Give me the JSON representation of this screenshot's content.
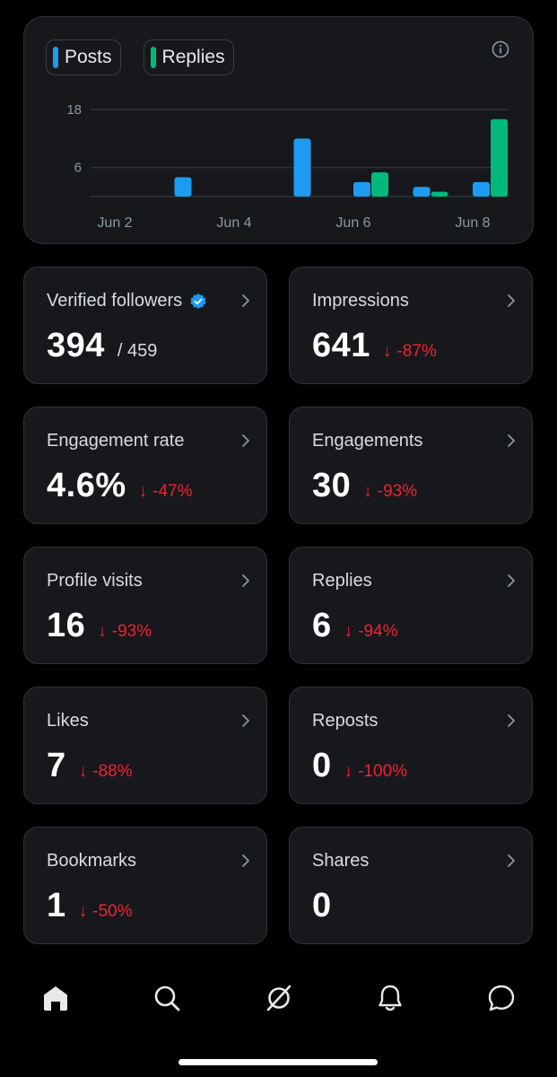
{
  "colors": {
    "posts": "#1d9bf0",
    "replies": "#00ba7c",
    "negative": "#f4212e",
    "verified": "#1d9bf0"
  },
  "legend": {
    "posts_label": "Posts",
    "replies_label": "Replies"
  },
  "chart_data": {
    "type": "bar",
    "y_ticks": [
      "18",
      "6"
    ],
    "x_ticks": [
      "Jun 2",
      "Jun 4",
      "Jun 6",
      "Jun 8"
    ],
    "categories": [
      "Jun 2",
      "Jun 3",
      "Jun 4",
      "Jun 5",
      "Jun 6",
      "Jun 7",
      "Jun 8"
    ],
    "series": [
      {
        "name": "Posts",
        "values": [
          0,
          4,
          0,
          12,
          3,
          2,
          3
        ]
      },
      {
        "name": "Replies",
        "values": [
          0,
          0,
          0,
          0,
          5,
          1,
          16
        ]
      }
    ],
    "ylim": [
      0,
      18
    ],
    "grid": true
  },
  "stats": [
    {
      "label": "Verified followers",
      "value": "394",
      "total": "/ 459",
      "verified": true,
      "icon": "verified-badge-icon"
    },
    {
      "label": "Impressions",
      "value": "641",
      "delta": "-87%"
    },
    {
      "label": "Engagement rate",
      "value": "4.6%",
      "delta": "-47%"
    },
    {
      "label": "Engagements",
      "value": "30",
      "delta": "-93%"
    },
    {
      "label": "Profile visits",
      "value": "16",
      "delta": "-93%"
    },
    {
      "label": "Replies",
      "value": "6",
      "delta": "-94%"
    },
    {
      "label": "Likes",
      "value": "7",
      "delta": "-88%"
    },
    {
      "label": "Reposts",
      "value": "0",
      "delta": "-100%"
    },
    {
      "label": "Bookmarks",
      "value": "1",
      "delta": "-50%"
    },
    {
      "label": "Shares",
      "value": "0"
    }
  ],
  "delta_arrow": "↓",
  "nav": [
    "home-icon",
    "search-icon",
    "grok-icon",
    "notifications-icon",
    "messages-icon"
  ]
}
